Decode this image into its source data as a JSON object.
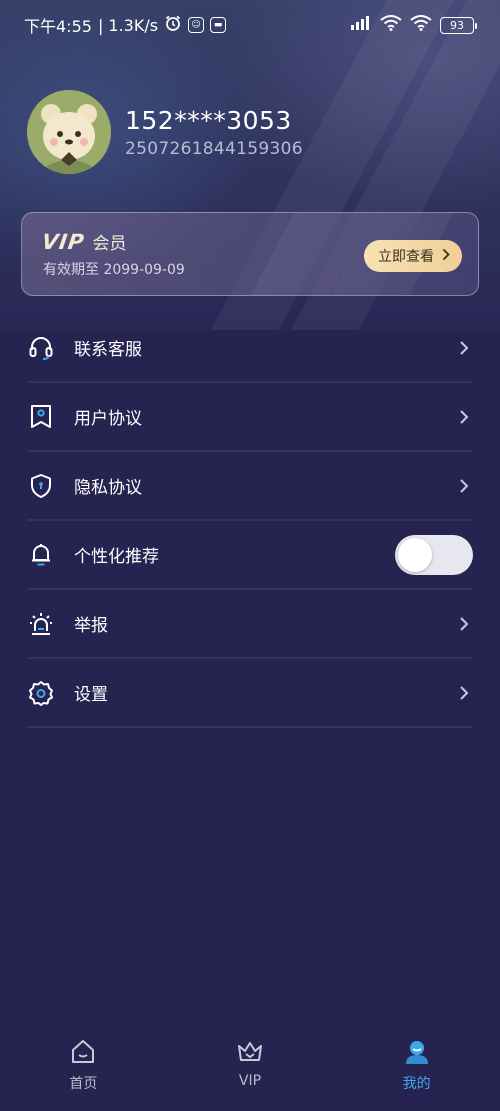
{
  "status_bar": {
    "time": "下午4:55",
    "speed": "| 1.3K/s",
    "battery": "93"
  },
  "profile": {
    "phone": "152****3053",
    "uid": "2507261844159306"
  },
  "vip_card": {
    "logo": "VIP",
    "title": "会员",
    "expire": "有效期至 2099-09-09",
    "button": "立即查看"
  },
  "menu": {
    "items": [
      {
        "label": "联系客服",
        "icon": "headset-icon",
        "control": "arrow"
      },
      {
        "label": "用户协议",
        "icon": "user-agreement-icon",
        "control": "arrow"
      },
      {
        "label": "隐私协议",
        "icon": "shield-icon",
        "control": "arrow"
      },
      {
        "label": "个性化推荐",
        "icon": "bell-icon",
        "control": "toggle",
        "enabled": false
      },
      {
        "label": "举报",
        "icon": "alarm-icon",
        "control": "arrow"
      },
      {
        "label": "设置",
        "icon": "gear-icon",
        "control": "arrow"
      }
    ]
  },
  "tabbar": {
    "tabs": [
      {
        "label": "首页",
        "icon": "home-icon",
        "active": false
      },
      {
        "label": "VIP",
        "icon": "crown-icon",
        "active": false
      },
      {
        "label": "我的",
        "icon": "profile-icon",
        "active": true
      }
    ]
  },
  "colors": {
    "background": "#272350",
    "accent_active": "#3fa8e8",
    "vip_button": "#efcf95"
  }
}
